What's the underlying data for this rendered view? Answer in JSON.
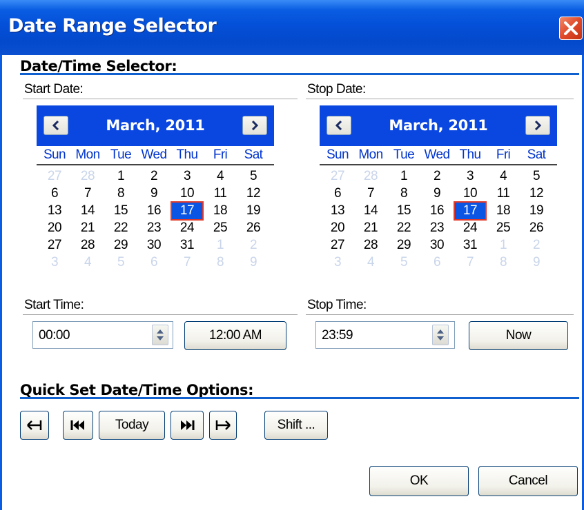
{
  "window": {
    "title": "Date Range Selector"
  },
  "sections": {
    "datetime": "Date/Time Selector:",
    "quickset": "Quick Set Date/Time Options:"
  },
  "start": {
    "date_label": "Start Date:",
    "time_label": "Start Time:",
    "time_value": "00:00",
    "ampm_button": "12:00 AM",
    "calendar": {
      "month": "March, 2011",
      "weekdays": [
        "Sun",
        "Mon",
        "Tue",
        "Wed",
        "Thu",
        "Fri",
        "Sat"
      ],
      "weeks": [
        [
          "27",
          "28",
          "1",
          "2",
          "3",
          "4",
          "5"
        ],
        [
          "6",
          "7",
          "8",
          "9",
          "10",
          "11",
          "12"
        ],
        [
          "13",
          "14",
          "15",
          "16",
          "17",
          "18",
          "19"
        ],
        [
          "20",
          "21",
          "22",
          "23",
          "24",
          "25",
          "26"
        ],
        [
          "27",
          "28",
          "29",
          "30",
          "31",
          "1",
          "2"
        ],
        [
          "3",
          "4",
          "5",
          "6",
          "7",
          "8",
          "9"
        ]
      ],
      "selected_day": "17"
    }
  },
  "stop": {
    "date_label": "Stop Date:",
    "time_label": "Stop Time:",
    "time_value": "23:59",
    "now_button": "Now",
    "calendar": {
      "month": "March, 2011",
      "weekdays": [
        "Sun",
        "Mon",
        "Tue",
        "Wed",
        "Thu",
        "Fri",
        "Sat"
      ],
      "weeks": [
        [
          "27",
          "28",
          "1",
          "2",
          "3",
          "4",
          "5"
        ],
        [
          "6",
          "7",
          "8",
          "9",
          "10",
          "11",
          "12"
        ],
        [
          "13",
          "14",
          "15",
          "16",
          "17",
          "18",
          "19"
        ],
        [
          "20",
          "21",
          "22",
          "23",
          "24",
          "25",
          "26"
        ],
        [
          "27",
          "28",
          "29",
          "30",
          "31",
          "1",
          "2"
        ],
        [
          "3",
          "4",
          "5",
          "6",
          "7",
          "8",
          "9"
        ]
      ],
      "selected_day": "17"
    }
  },
  "quickset": {
    "today_button": "Today",
    "shift_button": "Shift ..."
  },
  "footer": {
    "ok": "OK",
    "cancel": "Cancel"
  },
  "colors": {
    "titlebar": "#0450d8",
    "calendar_header": "#0a46e0",
    "weekday_text": "#0033cc",
    "selected_day_bg": "#0a55e4",
    "selected_day_border": "#e03a2a",
    "other_month_text": "#c9d5ea",
    "section_rule": "#1060d0"
  },
  "icons": {
    "close": "close-icon",
    "cal_prev": "chevron-left-icon",
    "cal_next": "chevron-right-icon",
    "spin": "spinner-arrows-icon",
    "shift_left": "arrow-to-left-icon",
    "first": "skip-first-icon",
    "last": "skip-last-icon",
    "shift_right": "arrow-to-right-icon"
  }
}
